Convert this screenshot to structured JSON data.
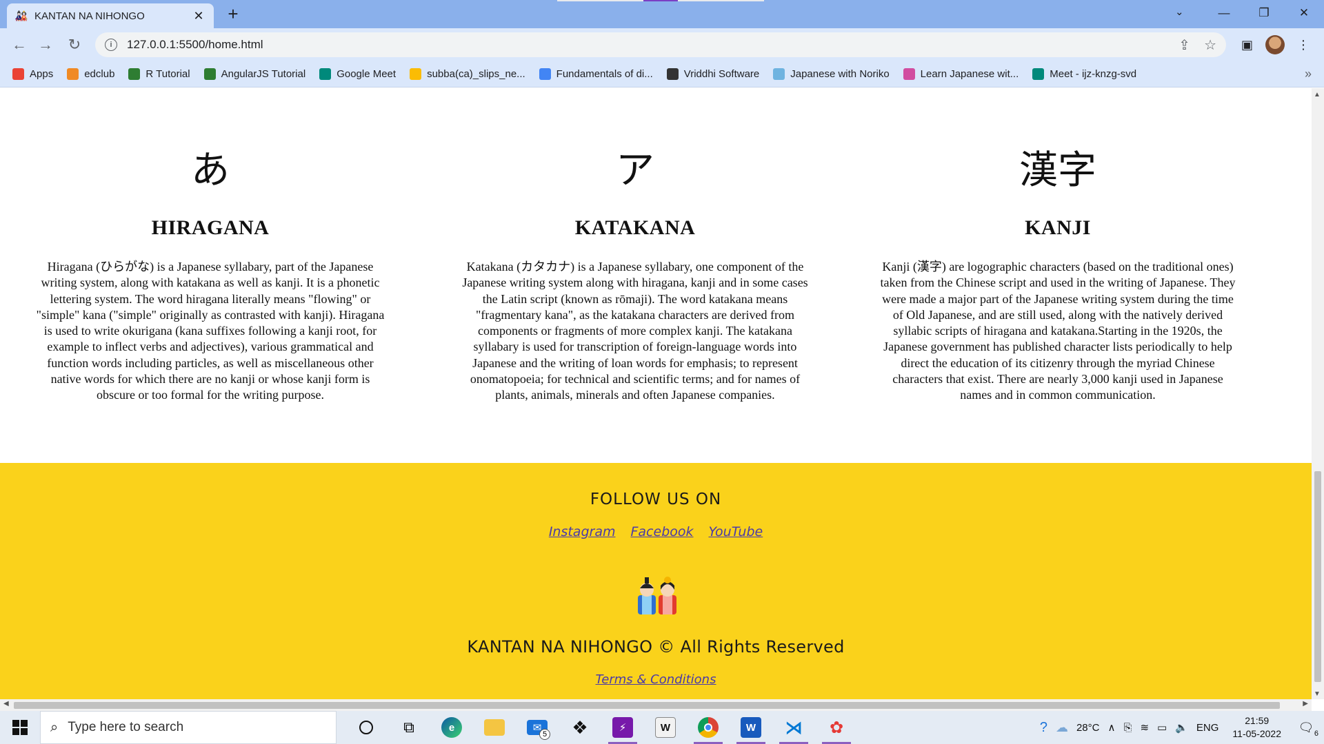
{
  "browser": {
    "tab_title": "KANTAN NA NIHONGO",
    "tab_close": "✕",
    "new_tab": "+",
    "url": "127.0.0.1:5500/home.html",
    "window_controls": [
      "⌄",
      "—",
      "❐",
      "✕"
    ],
    "nav": {
      "back": "←",
      "forward": "→",
      "reload": "↻"
    },
    "bookmarks": [
      {
        "label": "Apps",
        "icon": "apps-grid-icon",
        "color": "#ea4335"
      },
      {
        "label": "edclub",
        "icon": "edclub-icon",
        "color": "#f08a24"
      },
      {
        "label": "R Tutorial",
        "icon": "w3-icon",
        "color": "#2e7d32"
      },
      {
        "label": "AngularJS Tutorial",
        "icon": "w3-icon",
        "color": "#2e7d32"
      },
      {
        "label": "Google Meet",
        "icon": "google-meet-icon",
        "color": "#00897b"
      },
      {
        "label": "subba(ca)_slips_ne...",
        "icon": "google-drive-icon",
        "color": "#fbbc04"
      },
      {
        "label": "Fundamentals of di...",
        "icon": "google-icon",
        "color": "#4285f4"
      },
      {
        "label": "Vriddhi Software",
        "icon": "globe-icon",
        "color": "#333333"
      },
      {
        "label": "Japanese with Noriko",
        "icon": "site-icon",
        "color": "#6fb3e0"
      },
      {
        "label": "Learn Japanese wit...",
        "icon": "podcast-icon",
        "color": "#d14da0"
      },
      {
        "label": "Meet - ijz-knzg-svd",
        "icon": "google-meet-icon",
        "color": "#00897b"
      }
    ],
    "bookmarks_more": "»"
  },
  "cards": [
    {
      "glyph": "あ",
      "title": "HIRAGANA",
      "lines": [
        "Hiragana (ひらがな) is a Japanese syllabary, part of the Japanese",
        "writing system, along with katakana as well as kanji. It is a phonetic",
        "lettering system. The word hiragana literally means \"flowing\" or",
        "\"simple\" kana (\"simple\" originally as contrasted with kanji). Hiragana",
        "is used to write okurigana (kana suffixes following a kanji root, for",
        "example to inflect verbs and adjectives), various grammatical and",
        "function words including particles, as well as miscellaneous other",
        "native words for which there are no kanji or whose kanji form is",
        "obscure or too formal for the writing purpose."
      ]
    },
    {
      "glyph": "ア",
      "title": "KATAKANA",
      "lines": [
        "Katakana (カタカナ) is a Japanese syllabary, one component of the",
        "Japanese writing system along with hiragana, kanji and in some cases",
        "the Latin script (known as rōmaji). The word katakana means",
        "\"fragmentary kana\", as the katakana characters are derived from",
        "components or fragments of more complex kanji. The katakana",
        "syllabary is used for transcription of foreign-language words into",
        "Japanese and the writing of loan words for emphasis; to represent",
        "onomatopoeia; for technical and scientific terms; and for names of",
        "plants, animals, minerals and often Japanese companies."
      ]
    },
    {
      "glyph": "漢字",
      "title": "KANJI",
      "lines": [
        "Kanji (漢字) are logographic characters (based on the traditional ones)",
        "taken from the Chinese script and used in the writing of Japanese. They",
        "were made a major part of the Japanese writing system during the time",
        "of Old Japanese, and are still used, along with the natively derived",
        "syllabic scripts of hiragana and katakana.Starting in the 1920s, the",
        "Japanese government has published character lists periodically to help",
        "direct the education of its citizenry through the myriad Chinese",
        "characters that exist. There are nearly 3,000 kanji used in Japanese",
        "names and in common communication."
      ]
    }
  ],
  "footer": {
    "follow": "FOLLOW US ON",
    "social": [
      "Instagram",
      "Facebook",
      "YouTube"
    ],
    "copyright": "KANTAN NA NIHONGO  © All Rights Reserved",
    "terms": "Terms & Conditions",
    "accent": "#fad21b"
  },
  "taskbar": {
    "search_placeholder": "Type here to search",
    "mail_badge": "5",
    "weather": "28°C",
    "language": "ENG",
    "time": "21:59",
    "date": "11-05-2022",
    "notification_count": "6"
  }
}
